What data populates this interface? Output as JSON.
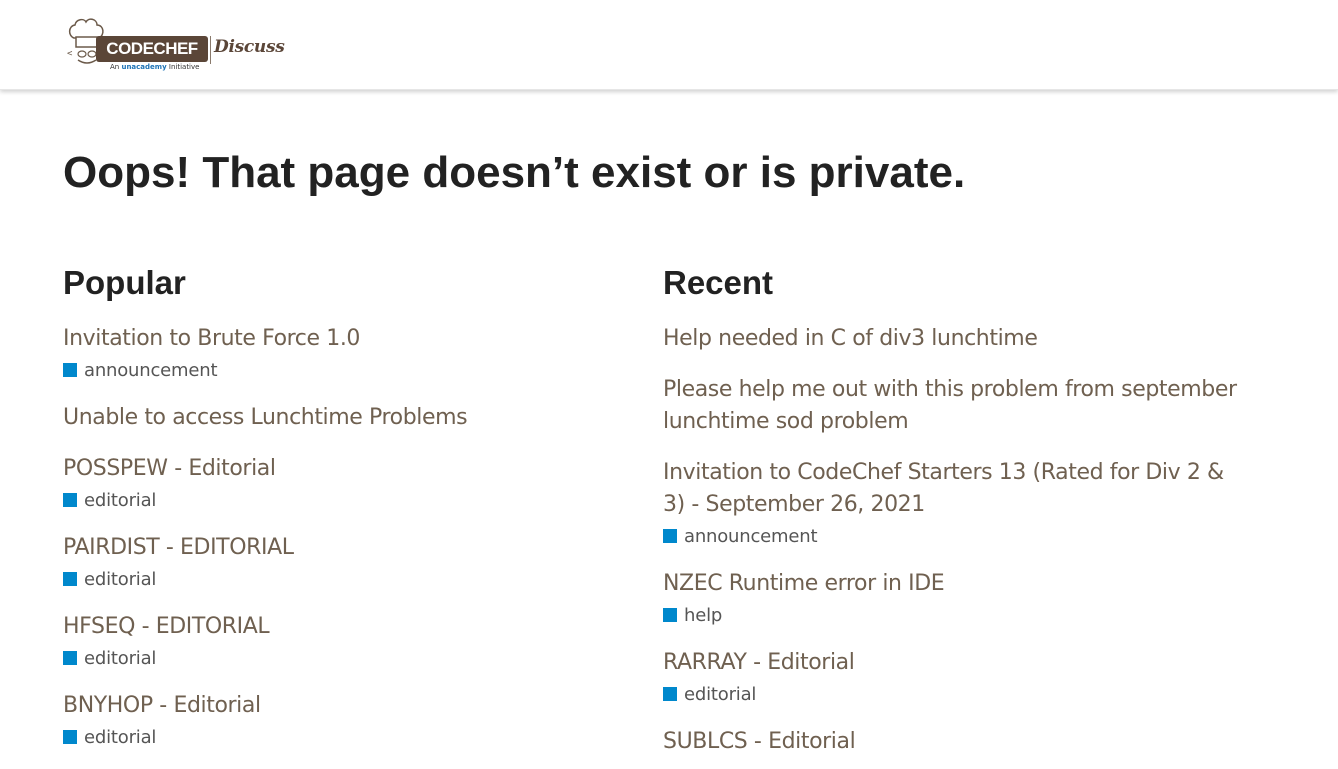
{
  "header": {
    "brand_name": "CODECHEF",
    "brand_suffix": "Discuss",
    "tagline_prefix": "An",
    "tagline_brand": "unacademy",
    "tagline_suffix": "Initiative"
  },
  "main": {
    "title": "Oops! That page doesn’t exist or is private."
  },
  "popular": {
    "heading": "Popular",
    "topics": [
      {
        "title": "Invitation to Brute Force 1.0",
        "category": "announcement"
      },
      {
        "title": "Unable to access Lunchtime Problems",
        "category": ""
      },
      {
        "title": "POSSPEW - Editorial",
        "category": "editorial"
      },
      {
        "title": "PAIRDIST - EDITORIAL",
        "category": "editorial"
      },
      {
        "title": "HFSEQ - EDITORIAL",
        "category": "editorial"
      },
      {
        "title": "BNYHOP - Editorial",
        "category": "editorial"
      }
    ]
  },
  "recent": {
    "heading": "Recent",
    "topics": [
      {
        "title": "Help needed in C of div3 lunchtime",
        "category": ""
      },
      {
        "title": "Please help me out with this problem from september lunchtime sod problem",
        "category": ""
      },
      {
        "title": "Invitation to CodeChef Starters 13 (Rated for Div 2 & 3) - September 26, 2021",
        "category": "announcement"
      },
      {
        "title": "NZEC Runtime error in IDE",
        "category": "help"
      },
      {
        "title": "RARRAY - Editorial",
        "category": "editorial"
      },
      {
        "title": "SUBLCS - Editorial",
        "category": ""
      }
    ]
  },
  "colors": {
    "link": "#6f6050",
    "category_swatch": "#0088cc",
    "brand": "#5b4638",
    "heading": "#222222"
  },
  "icons": {
    "logo": "chef-hat-icon"
  }
}
